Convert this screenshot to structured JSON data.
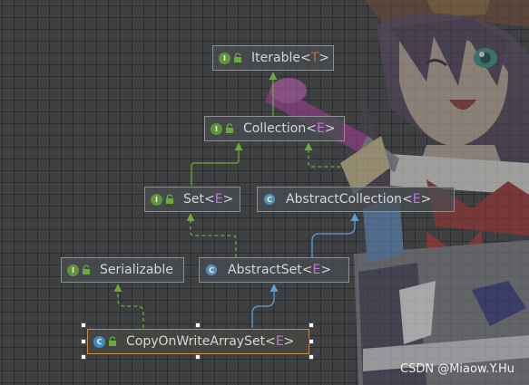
{
  "nodes": {
    "iterable": {
      "name": "Iterable",
      "type_param": "T",
      "kind": "interface"
    },
    "collection": {
      "name": "Collection",
      "type_param": "E",
      "kind": "interface"
    },
    "set": {
      "name": "Set",
      "type_param": "E",
      "kind": "interface"
    },
    "abstract_collection": {
      "name": "AbstractCollection",
      "type_param": "E",
      "kind": "abstract-class"
    },
    "serializable": {
      "name": "Serializable",
      "kind": "interface"
    },
    "abstract_set": {
      "name": "AbstractSet",
      "type_param": "E",
      "kind": "abstract-class"
    },
    "copy_on_write_array_set": {
      "name": "CopyOnWriteArraySet",
      "type_param": "E",
      "kind": "class",
      "selected": true
    }
  },
  "edges": [
    {
      "from": "Collection",
      "to": "Iterable",
      "relation": "extends"
    },
    {
      "from": "Set",
      "to": "Collection",
      "relation": "extends"
    },
    {
      "from": "AbstractCollection",
      "to": "Collection",
      "relation": "implements"
    },
    {
      "from": "AbstractSet",
      "to": "Set",
      "relation": "implements"
    },
    {
      "from": "AbstractSet",
      "to": "AbstractCollection",
      "relation": "extends"
    },
    {
      "from": "CopyOnWriteArraySet",
      "to": "Serializable",
      "relation": "implements"
    },
    {
      "from": "CopyOnWriteArraySet",
      "to": "AbstractSet",
      "relation": "extends"
    }
  ],
  "colors": {
    "interface_edge": "#6aab3c",
    "extends_class_edge": "#5c9ddc",
    "selection_border": "#c58a46"
  },
  "watermark": "CSDN @Miaow.Y.Hu"
}
